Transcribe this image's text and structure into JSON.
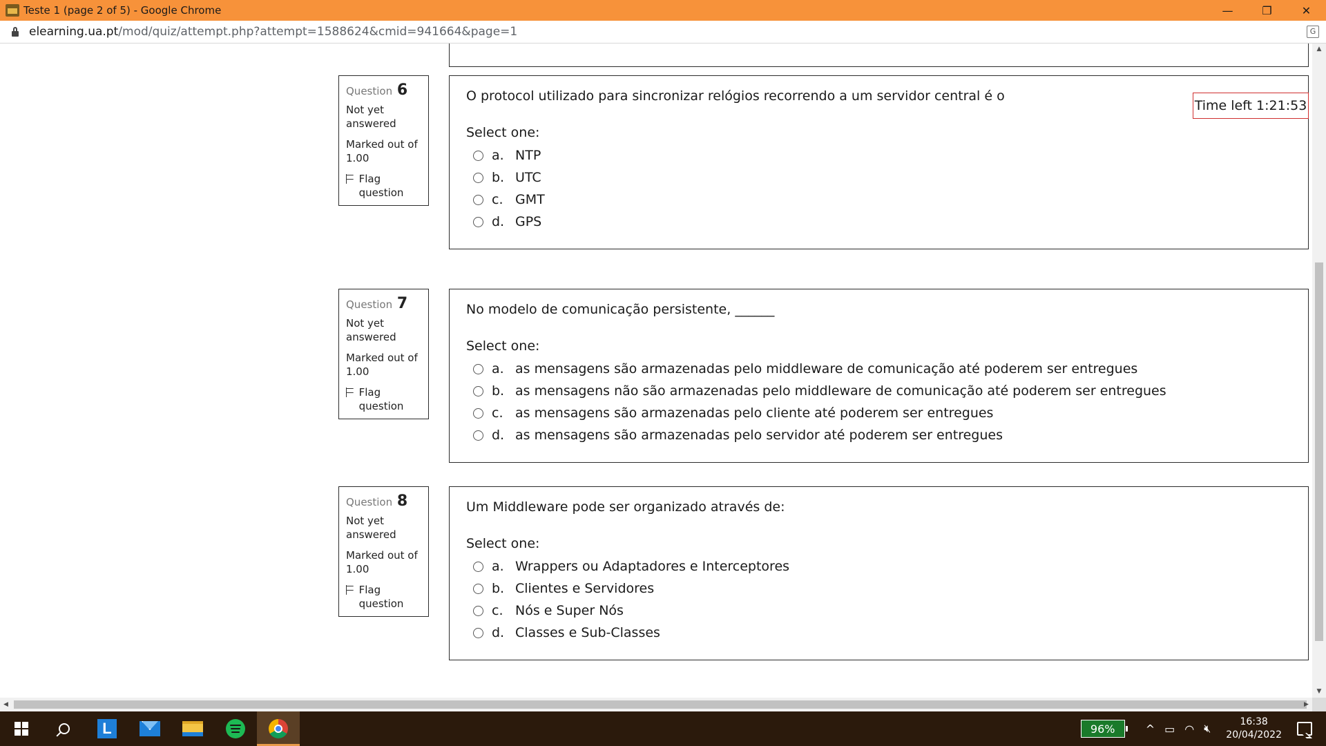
{
  "window": {
    "title": "Teste 1 (page 2 of 5) - Google Chrome",
    "controls": {
      "minimize": "—",
      "restore": "❐",
      "close": "✕"
    }
  },
  "address": {
    "host": "elearning.ua.pt",
    "path": "/mod/quiz/attempt.php?attempt=1588624&cmid=941664&page=1"
  },
  "timer": {
    "label": "Time left 1:21:53"
  },
  "questions": [
    {
      "label": "Question",
      "number": "6",
      "state": "Not yet answered",
      "grade": "Marked out of 1.00",
      "flag": "Flag question",
      "text": "O protocol utilizado para sincronizar relógios recorrendo a um servidor central é o",
      "prompt": "Select one:",
      "options": [
        {
          "letter": "a.",
          "text": "NTP"
        },
        {
          "letter": "b.",
          "text": "UTC"
        },
        {
          "letter": "c.",
          "text": "GMT"
        },
        {
          "letter": "d.",
          "text": "GPS"
        }
      ]
    },
    {
      "label": "Question",
      "number": "7",
      "state": "Not yet answered",
      "grade": "Marked out of 1.00",
      "flag": "Flag question",
      "text": "No modelo de comunicação persistente, ______",
      "prompt": "Select one:",
      "options": [
        {
          "letter": "a.",
          "text": "as mensagens são armazenadas pelo middleware de comunicação até poderem ser entregues"
        },
        {
          "letter": "b.",
          "text": "as mensagens não são armazenadas pelo middleware de comunicação até poderem ser entregues"
        },
        {
          "letter": "c.",
          "text": "as mensagens são armazenadas pelo cliente até poderem ser entregues"
        },
        {
          "letter": "d.",
          "text": "as mensagens são armazenadas pelo servidor até poderem ser entregues"
        }
      ]
    },
    {
      "label": "Question",
      "number": "8",
      "state": "Not yet answered",
      "grade": "Marked out of 1.00",
      "flag": "Flag question",
      "text": "Um Middleware pode ser organizado através de:",
      "prompt": "Select one:",
      "options": [
        {
          "letter": "a.",
          "text": "Wrappers ou Adaptadores e Interceptores"
        },
        {
          "letter": "b.",
          "text": "Clientes e Servidores"
        },
        {
          "letter": "c.",
          "text": "Nós e Super Nós"
        },
        {
          "letter": "d.",
          "text": "Classes e Sub-Classes"
        }
      ]
    }
  ],
  "taskbar": {
    "apps": [
      "windows-start",
      "search",
      "l-app",
      "mail",
      "file-explorer",
      "spotify",
      "chrome"
    ],
    "battery": "96%",
    "time": "16:38",
    "date": "20/04/2022",
    "tray": {
      "chevron": "^",
      "battery_glyph": "▭",
      "wifi_glyph": "◠",
      "volume_glyph": "🔇︎"
    }
  },
  "colors": {
    "titlebar": "#f7923a",
    "taskbar": "#2b1a0c",
    "timer_border": "#cf2e2e",
    "battery_badge": "#1a7a2a"
  }
}
